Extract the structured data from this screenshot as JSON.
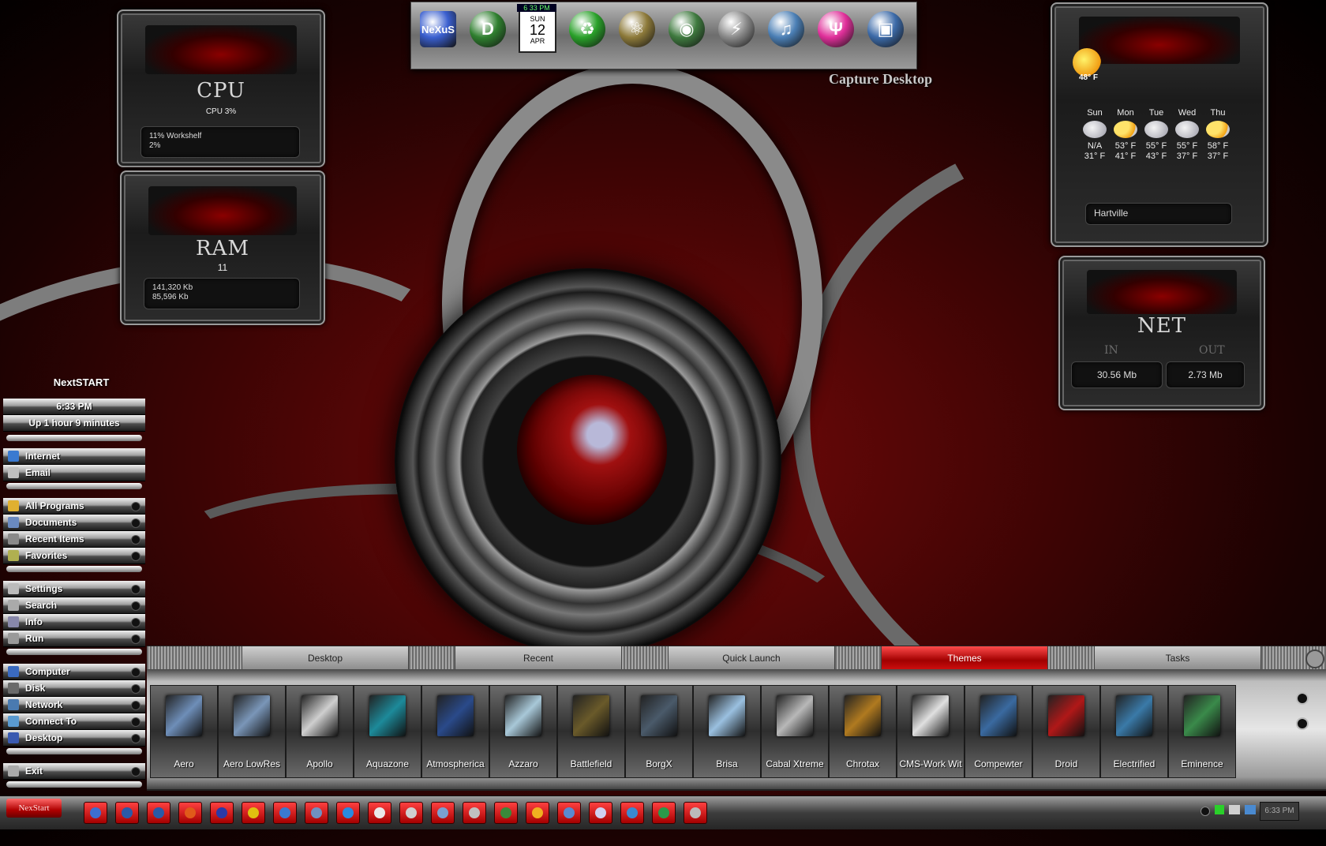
{
  "dock": {
    "items": [
      {
        "name": "nexus-icon",
        "label": "NeXuS",
        "color": "#3a5fcf"
      },
      {
        "name": "dexpot-icon",
        "label": "D",
        "color": "#2f7f2f"
      },
      {
        "name": "calendar-icon",
        "label": "12",
        "color": "#ffffff"
      },
      {
        "name": "recycle-bin-icon",
        "label": "♻",
        "color": "#2aa12a"
      },
      {
        "name": "atom-icon",
        "label": "⚛",
        "color": "#8d7a3a"
      },
      {
        "name": "globe-icon",
        "label": "◉",
        "color": "#3f7a3f"
      },
      {
        "name": "lightning-icon",
        "label": "⚡",
        "color": "#8a8a8a"
      },
      {
        "name": "music-disc-icon",
        "label": "♫",
        "color": "#4b7fb5"
      },
      {
        "name": "pink-orb-icon",
        "label": "Ψ",
        "color": "#e0309a"
      },
      {
        "name": "camera-icon",
        "label": "▣",
        "color": "#3c6aa8"
      }
    ],
    "clock": "6 33 PM",
    "cal_day": "SUN",
    "cal_date": "12",
    "cal_month": "APR"
  },
  "capture_label": "Capture Desktop",
  "cpu": {
    "title": "CPU",
    "value": "CPU 3%",
    "line1": "11% Workshelf",
    "line2": "2%"
  },
  "ram": {
    "title": "RAM",
    "value": "11",
    "line1": "141,320 Kb",
    "line2": "85,596 Kb"
  },
  "weather": {
    "current_temp": "48° F",
    "days": [
      {
        "day": "Sun",
        "high": "N/A",
        "low": "31° F",
        "icon": "cloud"
      },
      {
        "day": "Mon",
        "high": "53° F",
        "low": "41° F",
        "icon": "sun"
      },
      {
        "day": "Tue",
        "high": "55° F",
        "low": "43° F",
        "icon": "rain"
      },
      {
        "day": "Wed",
        "high": "55° F",
        "low": "37° F",
        "icon": "rain"
      },
      {
        "day": "Thu",
        "high": "58° F",
        "low": "37° F",
        "icon": "sun"
      }
    ],
    "location": "Hartville"
  },
  "net": {
    "title": "NET",
    "in_label": "IN",
    "out_label": "OUT",
    "in_value": "30.56 Mb",
    "out_value": "2.73 Mb"
  },
  "nextstart": {
    "title": "NextSTART",
    "time": "6:33 PM",
    "uptime": "Up 1 hour 9 minutes",
    "items": [
      {
        "label": "Internet",
        "arrow": false
      },
      {
        "label": "Email",
        "arrow": false
      },
      {
        "label": "All Programs",
        "arrow": true
      },
      {
        "label": "Documents",
        "arrow": true
      },
      {
        "label": "Recent Items",
        "arrow": true
      },
      {
        "label": "Favorites",
        "arrow": true
      },
      {
        "label": "Settings",
        "arrow": true
      },
      {
        "label": "Search",
        "arrow": true
      },
      {
        "label": "Info",
        "arrow": true
      },
      {
        "label": "Run",
        "arrow": true
      },
      {
        "label": "Computer",
        "arrow": true
      },
      {
        "label": "Disk",
        "arrow": true
      },
      {
        "label": "Network",
        "arrow": true
      },
      {
        "label": "Connect To",
        "arrow": true
      },
      {
        "label": "Desktop",
        "arrow": true
      },
      {
        "label": "Exit",
        "arrow": true
      }
    ]
  },
  "shelf": {
    "tabs": [
      {
        "label": "Desktop",
        "active": false
      },
      {
        "label": "Recent",
        "active": false
      },
      {
        "label": "Quick Launch",
        "active": false
      },
      {
        "label": "Themes",
        "active": true
      },
      {
        "label": "Tasks",
        "active": false
      }
    ],
    "themes": [
      {
        "name": "Aero",
        "color": "#6e8eb8"
      },
      {
        "name": "Aero LowRes",
        "color": "#7a96b8"
      },
      {
        "name": "Apollo",
        "color": "#cfcfcf"
      },
      {
        "name": "Aquazone",
        "color": "#1d8a9a"
      },
      {
        "name": "Atmospherica",
        "color": "#2a4a8a"
      },
      {
        "name": "Azzaro",
        "color": "#a8c8d8"
      },
      {
        "name": "Battlefield",
        "color": "#6a5a2a"
      },
      {
        "name": "BorgX",
        "color": "#4a5a6a"
      },
      {
        "name": "Brisa",
        "color": "#9ac0e0"
      },
      {
        "name": "Cabal Xtreme",
        "color": "#b8b8b8"
      },
      {
        "name": "Chrotax",
        "color": "#b07a20"
      },
      {
        "name": "CMS-Work Wit",
        "color": "#e0e0e0"
      },
      {
        "name": "Compewter",
        "color": "#3a6aa0"
      },
      {
        "name": "Droid",
        "color": "#b01818"
      },
      {
        "name": "Electrified",
        "color": "#3a7aa8"
      },
      {
        "name": "Eminence",
        "color": "#3a8a4a"
      }
    ]
  },
  "taskbar": {
    "start_label": "NexStart",
    "icons": [
      "#3d6fd0",
      "#2a5aa8",
      "#2a5aa8",
      "#e05a1a",
      "#2a3aa8",
      "#e0c010",
      "#3a7ad0",
      "#7090c0",
      "#2a8ae0",
      "#eaeaea",
      "#cfcfcf",
      "#7aa0d0",
      "#c0c0c0",
      "#3a8a3a",
      "#f0b020",
      "#5a8ad0",
      "#d0d0f0",
      "#3a8ad0",
      "#2a9a4a",
      "#bbbbbb"
    ],
    "clock": "6:33 PM"
  }
}
